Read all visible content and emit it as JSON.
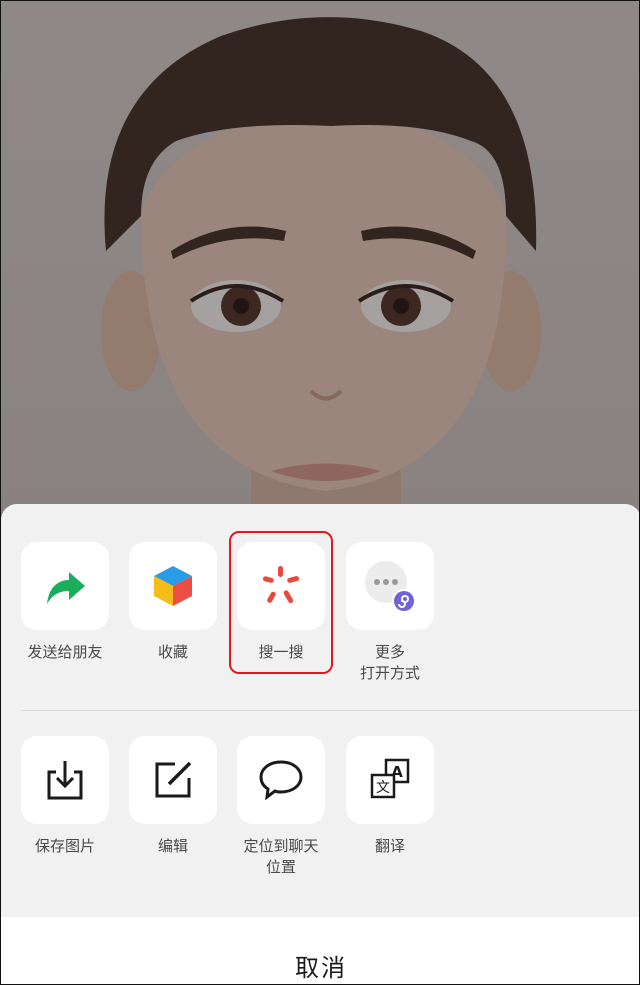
{
  "share_sheet": {
    "row1": [
      {
        "label": "发送给朋友",
        "icon": "share-arrow-icon"
      },
      {
        "label": "收藏",
        "icon": "favorite-cube-icon"
      },
      {
        "label": "搜一搜",
        "icon": "search-spark-icon",
        "highlighted": true
      },
      {
        "label_line1": "更多",
        "label_line2": "打开方式",
        "icon": "more-mini-program-icon"
      }
    ],
    "row2": [
      {
        "label": "保存图片",
        "icon": "download-icon"
      },
      {
        "label": "编辑",
        "icon": "edit-icon"
      },
      {
        "label_line1": "定位到聊天",
        "label_line2": "位置",
        "icon": "chat-bubble-icon"
      },
      {
        "label": "翻译",
        "icon": "translate-icon"
      }
    ],
    "cancel_label": "取消"
  },
  "colors": {
    "share_green": "#1aad5a",
    "highlight_red": "#e0191e",
    "search_red": "#e8493f",
    "mini_program_purple": "#6f63d9"
  }
}
